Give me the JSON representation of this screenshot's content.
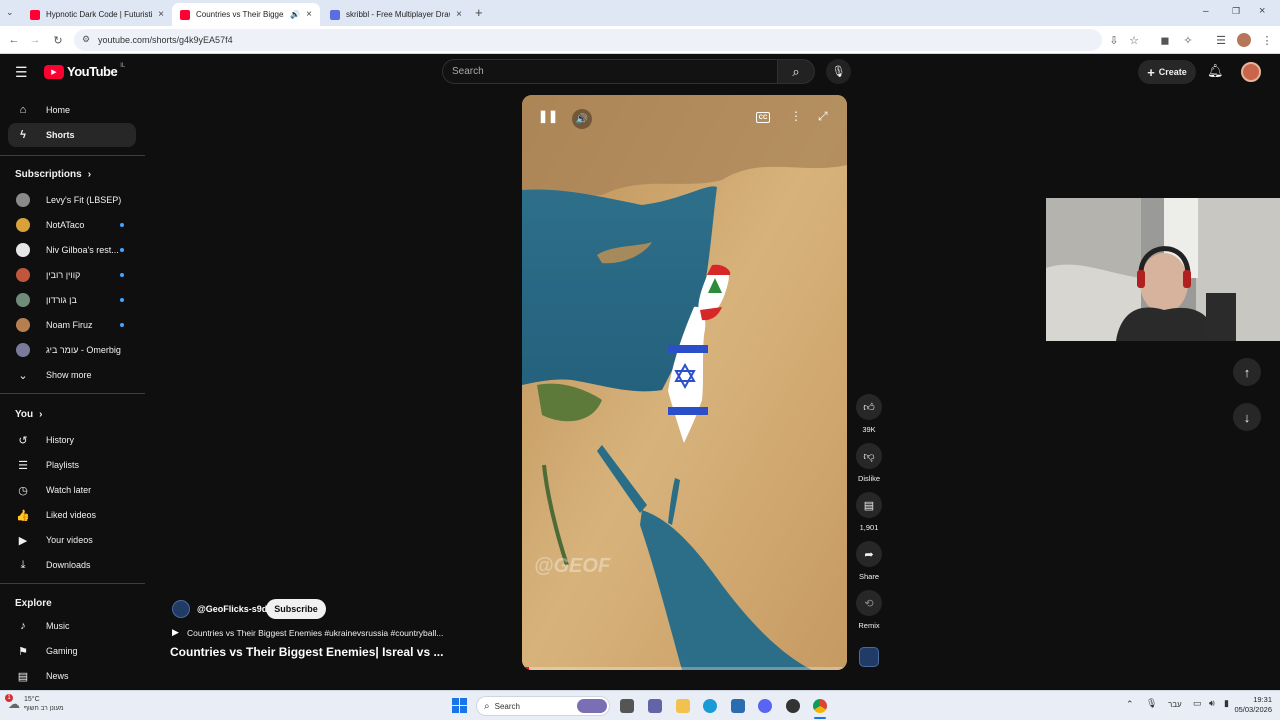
{
  "browser": {
    "tabs": [
      {
        "title": "Hypnotic Dark Code | Futuristic",
        "favicon_color": "#ff0033"
      },
      {
        "title": "Countries vs Their Biggest E",
        "favicon_color": "#ff0033"
      },
      {
        "title": "skribbl - Free Multiplayer Drawi",
        "favicon_color": "#5b6ee1"
      }
    ],
    "new_tab_glyph": "+",
    "url": "youtube.com/shorts/g4k9yEA57f4"
  },
  "youtube": {
    "logo_text": "YouTube",
    "logo_region": "IL",
    "search_placeholder": "Search",
    "create_label": "Create",
    "sidebar": {
      "main": [
        {
          "label": "Home",
          "icon": "home-icon",
          "glyph": "⌂"
        },
        {
          "label": "Shorts",
          "icon": "shorts-icon",
          "glyph": "ϟ"
        }
      ],
      "subscriptions_header": "Subscriptions",
      "subscriptions": [
        {
          "label": "Levy's Fit (LBSEP)",
          "color": "#8a8a8a",
          "new": false
        },
        {
          "label": "NotATaco",
          "color": "#d8a13a",
          "new": true
        },
        {
          "label": "Niv Gilboa's rest...",
          "color": "#e6e6e6",
          "new": true
        },
        {
          "label": "קווין רובין",
          "color": "#c0563c",
          "new": true
        },
        {
          "label": "בן גורדון",
          "color": "#6f8c7a",
          "new": true
        },
        {
          "label": "Noam Firuz",
          "color": "#b67f52",
          "new": true
        },
        {
          "label": "עומר ביג - Omerbig",
          "color": "#7a7a9a",
          "new": false
        }
      ],
      "show_more": "Show more",
      "you_header": "You",
      "you": [
        {
          "label": "History",
          "icon": "history-icon",
          "glyph": "↺"
        },
        {
          "label": "Playlists",
          "icon": "playlists-icon",
          "glyph": "☰"
        },
        {
          "label": "Watch later",
          "icon": "clock-icon",
          "glyph": "◷"
        },
        {
          "label": "Liked videos",
          "icon": "thumbs-up-icon",
          "glyph": "👍"
        },
        {
          "label": "Your videos",
          "icon": "your-videos-icon",
          "glyph": "▶"
        },
        {
          "label": "Downloads",
          "icon": "download-icon",
          "glyph": "⤓"
        }
      ],
      "explore_header": "Explore",
      "explore": [
        {
          "label": "Music",
          "icon": "music-icon",
          "glyph": "♪"
        },
        {
          "label": "Gaming",
          "icon": "gaming-icon",
          "glyph": "⚑"
        },
        {
          "label": "News",
          "icon": "news-icon",
          "glyph": "▤"
        }
      ]
    },
    "short": {
      "watermark": "@GEOF",
      "channel": "@GeoFlicks-s9d",
      "subscribe_label": "Subscribe",
      "hashtags": "Countries vs Their Biggest Enemies #ukrainevsrussia #countryball...",
      "title": "Countries vs Their Biggest Enemies| Isreal vs ...",
      "progress": 0.02,
      "actions": {
        "likes": "39K",
        "dislike_label": "Dislike",
        "comments": "1,901",
        "share_label": "Share",
        "remix_label": "Remix"
      }
    }
  },
  "taskbar": {
    "weather_temp": "15°C",
    "weather_text": "מעונן רב חשוף",
    "search_label": "Search",
    "language": "עבר",
    "time": "19:31",
    "date": "05/03/2026",
    "notification_count": "1"
  }
}
